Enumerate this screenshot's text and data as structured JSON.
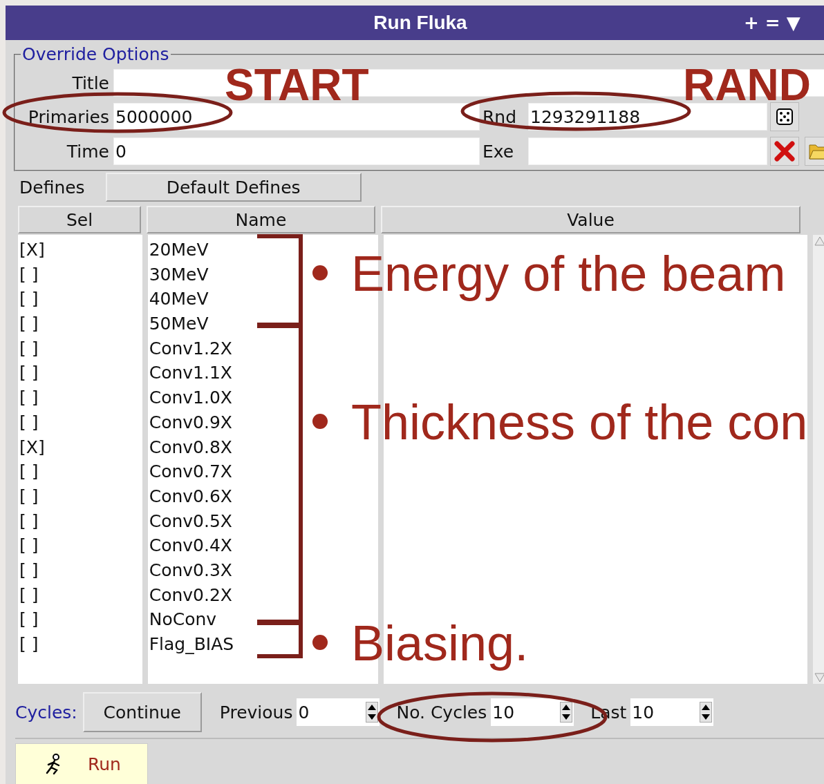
{
  "window": {
    "title": "Run Fluka",
    "title_buttons": "+ = ▼"
  },
  "override_options": {
    "legend": "Override Options",
    "title_label": "Title",
    "primaries": {
      "label": "Primaries",
      "value": "5000000"
    },
    "rnd": {
      "label": "Rnd",
      "value": "1293291188"
    },
    "time": {
      "label": "Time",
      "value": "0"
    },
    "exe_label": "Exe"
  },
  "defines": {
    "label": "Defines",
    "button": "Default Defines"
  },
  "table": {
    "columns": [
      "Sel",
      "Name",
      "Value"
    ],
    "rows": [
      {
        "sel": "[X]",
        "name": "20MeV"
      },
      {
        "sel": "[ ]",
        "name": "30MeV"
      },
      {
        "sel": "[ ]",
        "name": "40MeV"
      },
      {
        "sel": "[ ]",
        "name": "50MeV"
      },
      {
        "sel": "[ ]",
        "name": "Conv1.2X"
      },
      {
        "sel": "[ ]",
        "name": "Conv1.1X"
      },
      {
        "sel": "[ ]",
        "name": "Conv1.0X"
      },
      {
        "sel": "[ ]",
        "name": "Conv0.9X"
      },
      {
        "sel": "[X]",
        "name": "Conv0.8X"
      },
      {
        "sel": "[ ]",
        "name": "Conv0.7X"
      },
      {
        "sel": "[ ]",
        "name": "Conv0.6X"
      },
      {
        "sel": "[ ]",
        "name": "Conv0.5X"
      },
      {
        "sel": "[ ]",
        "name": "Conv0.4X"
      },
      {
        "sel": "[ ]",
        "name": "Conv0.3X"
      },
      {
        "sel": "[ ]",
        "name": "Conv0.2X"
      },
      {
        "sel": "[ ]",
        "name": "NoConv"
      },
      {
        "sel": "[ ]",
        "name": "Flag_BIAS"
      }
    ]
  },
  "cycles": {
    "label": "Cycles:",
    "button": "Continue",
    "spinners": [
      {
        "label": "Previous",
        "value": "0"
      },
      {
        "label": "No. Cycles",
        "value": "10"
      },
      {
        "label": "Last",
        "value": "10"
      }
    ]
  },
  "tabs": [
    {
      "label": "Run",
      "selected": true
    }
  ],
  "annotations": {
    "labels": [
      "START",
      "RAND"
    ],
    "bullets": [
      "Energy of the beam",
      "Thickness of the con",
      "Biasing."
    ]
  }
}
